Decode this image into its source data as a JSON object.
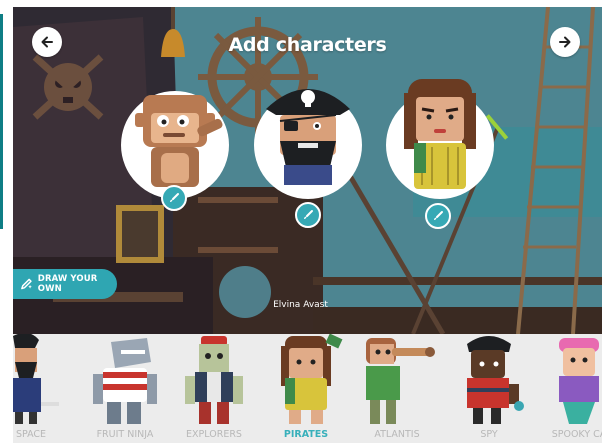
{
  "header": {
    "title": "Add characters"
  },
  "navigation": {
    "prev_icon": "arrow-left-icon",
    "next_icon": "arrow-right-icon"
  },
  "selected_characters": [
    {
      "id": "monkey",
      "icon": "brush-icon"
    },
    {
      "id": "pirate-captain",
      "icon": "brush-icon"
    },
    {
      "id": "pirate-girl",
      "icon": "brush-icon"
    }
  ],
  "draw_button": {
    "label": "DRAW YOUR OWN",
    "icon": "pencil-icon"
  },
  "hover_name": "Elvina Avast",
  "categories": [
    {
      "label": "SPACE"
    },
    {
      "label": "FRUIT NINJA"
    },
    {
      "label": "EXPLORERS"
    },
    {
      "label": "PIRATES",
      "selected": true
    },
    {
      "label": "ATLANTIS"
    },
    {
      "label": "SPY"
    },
    {
      "label": "SPOOKY CA"
    }
  ],
  "colors": {
    "accent": "#38b0bb",
    "label_inactive": "#b8b8b8",
    "tray_bg": "#ececec"
  }
}
